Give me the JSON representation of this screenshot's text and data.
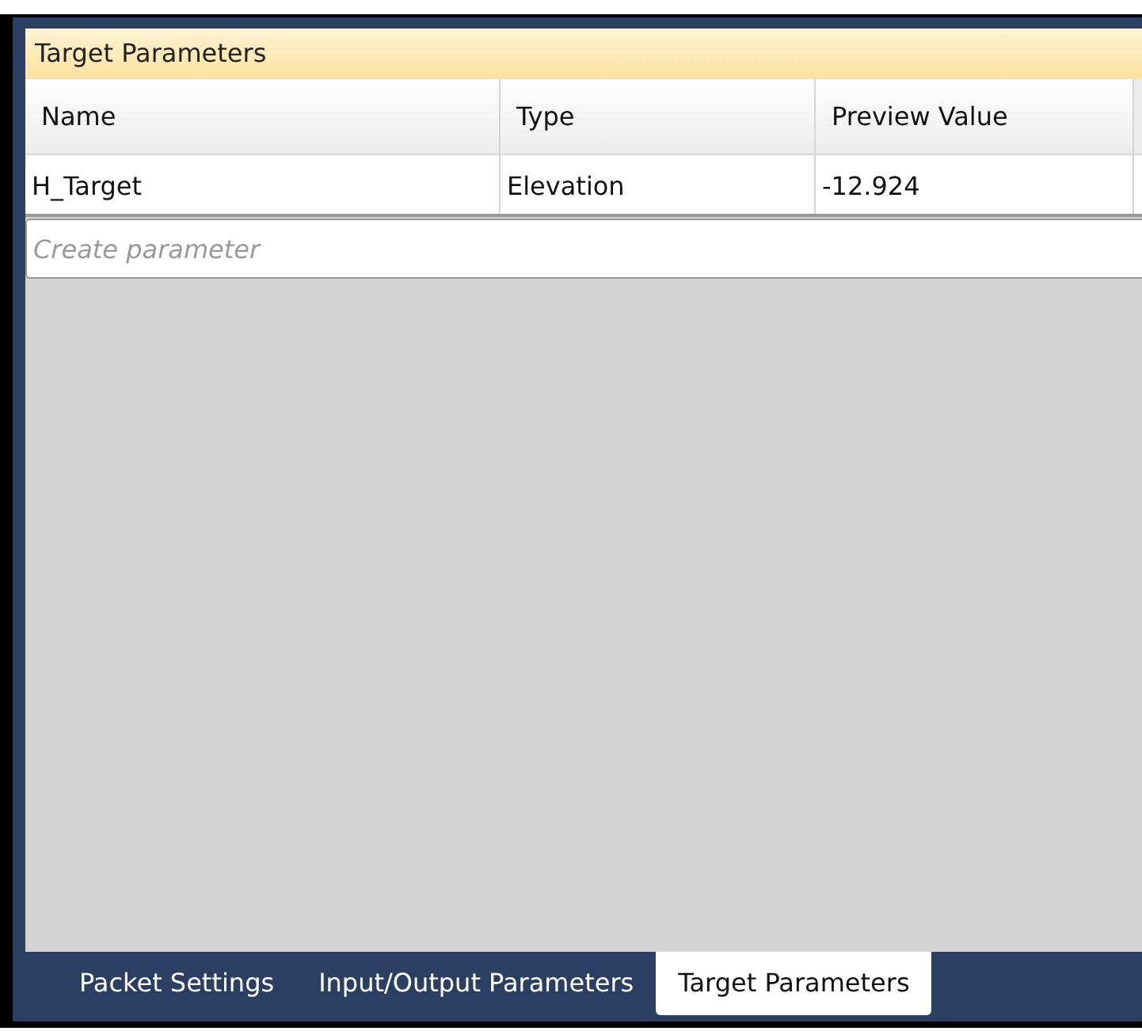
{
  "panel": {
    "title": "Target Parameters"
  },
  "table": {
    "columns": [
      "Name",
      "Type",
      "Preview Value"
    ],
    "rows": [
      [
        "H_Target",
        "Elevation",
        "-12.924"
      ]
    ]
  },
  "create_field": {
    "placeholder": "Create parameter"
  },
  "tabs": [
    {
      "label": "Packet Settings",
      "selected": false
    },
    {
      "label": "Input/Output Parameters",
      "selected": false
    },
    {
      "label": "Target Parameters",
      "selected": true
    }
  ]
}
